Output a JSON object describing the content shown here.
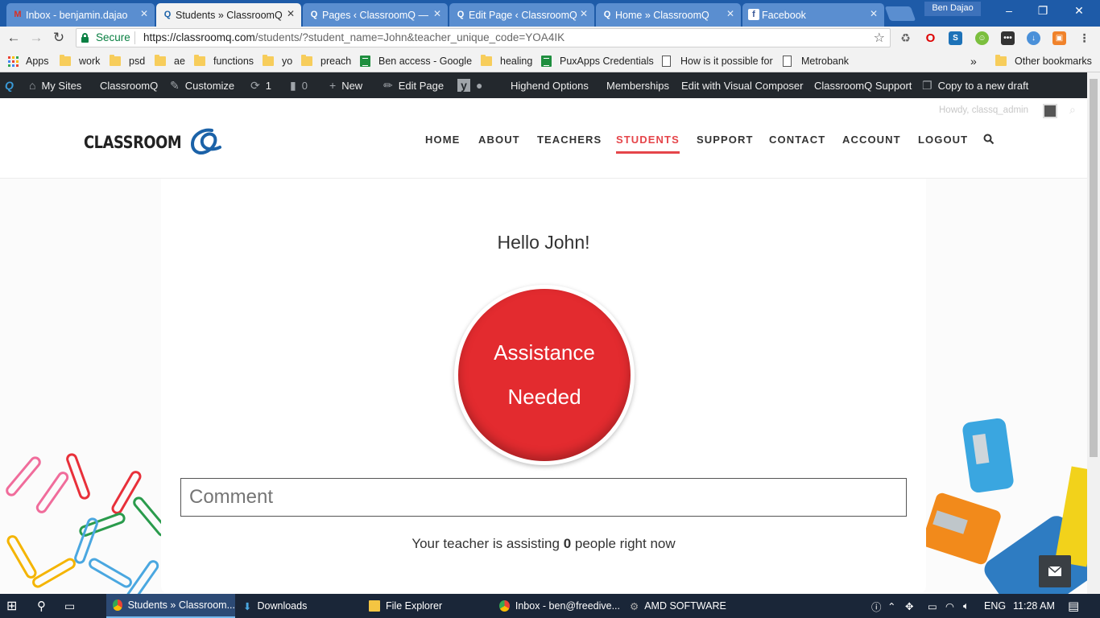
{
  "browser": {
    "tabs": [
      {
        "label": "Inbox - benjamin.dajao",
        "favicon": "gmail-icon",
        "active": false
      },
      {
        "label": "Students » ClassroomQ",
        "favicon": "classroomq-icon",
        "active": true
      },
      {
        "label": "Pages ‹ ClassroomQ —",
        "favicon": "classroomq-icon",
        "active": false
      },
      {
        "label": "Edit Page ‹ ClassroomQ",
        "favicon": "classroomq-icon",
        "active": false
      },
      {
        "label": "Home » ClassroomQ",
        "favicon": "classroomq-icon",
        "active": false
      },
      {
        "label": "Facebook",
        "favicon": "facebook-icon",
        "active": false
      }
    ],
    "profile_name": "Ben Dajao",
    "secure_label": "Secure",
    "url_host": "https://classroomq.com",
    "url_path": "/students/?student_name=John&teacher_unique_code=YOA4IK",
    "bookmarks": [
      {
        "label": "Apps",
        "type": "apps"
      },
      {
        "label": "work",
        "type": "folder"
      },
      {
        "label": "psd",
        "type": "folder"
      },
      {
        "label": "ae",
        "type": "folder"
      },
      {
        "label": "functions",
        "type": "folder"
      },
      {
        "label": "yo",
        "type": "folder"
      },
      {
        "label": "preach",
        "type": "folder"
      },
      {
        "label": "Ben access - Google",
        "type": "sheet"
      },
      {
        "label": "healing",
        "type": "folder"
      },
      {
        "label": "PuxApps Credentials",
        "type": "sheet"
      },
      {
        "label": "How is it possible for",
        "type": "page"
      },
      {
        "label": "Metrobank",
        "type": "page"
      }
    ],
    "overflow": "»",
    "other_bookmarks": "Other bookmarks"
  },
  "wp_admin_bar": {
    "items": [
      {
        "label": "My Sites",
        "icon": "my-sites-icon"
      },
      {
        "label": "ClassroomQ",
        "icon": ""
      },
      {
        "label": "Customize",
        "icon": "brush-icon"
      },
      {
        "label": "1",
        "icon": "updates-icon"
      },
      {
        "label": "0",
        "icon": "comments-icon"
      },
      {
        "label": "New",
        "icon": "plus-icon"
      },
      {
        "label": "Edit Page",
        "icon": "pencil-icon"
      },
      {
        "label": "Highend Options",
        "icon": ""
      },
      {
        "label": "Memberships",
        "icon": ""
      },
      {
        "label": "Edit with Visual Composer",
        "icon": ""
      },
      {
        "label": "ClassroomQ Support",
        "icon": ""
      },
      {
        "label": "Copy to a new draft",
        "icon": "copy-icon"
      }
    ],
    "howdy": "Howdy, classq_admin"
  },
  "site": {
    "logo_text": "CLASSROOM",
    "nav": [
      "HOME",
      "ABOUT",
      "TEACHERS",
      "STUDENTS",
      "SUPPORT",
      "CONTACT",
      "ACCOUNT",
      "LOGOUT"
    ],
    "active_nav": "STUDENTS"
  },
  "main": {
    "greeting": "Hello John!",
    "assist_line1": "Assistance",
    "assist_line2": "Needed",
    "comment_placeholder": "Comment",
    "status_prefix": "Your teacher is assisting ",
    "status_count": "0",
    "status_suffix": " people right now"
  },
  "taskbar": {
    "items": [
      {
        "label": "Students » Classroom...",
        "active": true
      },
      {
        "label": "Downloads",
        "active": false
      },
      {
        "label": "File Explorer",
        "active": false
      },
      {
        "label": "Inbox - ben@freedive...",
        "active": false
      },
      {
        "label": "AMD SOFTWARE",
        "active": false
      }
    ],
    "lang": "ENG",
    "time": "11:28 AM"
  },
  "colors": {
    "accent_red": "#e5454a",
    "button_red": "#e32b2f",
    "chrome_blue": "#1e5ba8",
    "wp_bar": "#23282d"
  }
}
